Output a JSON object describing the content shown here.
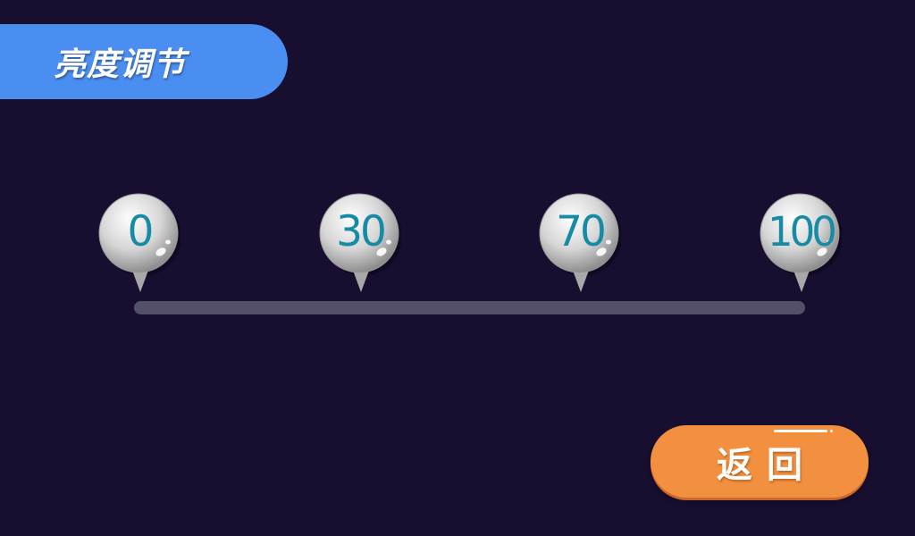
{
  "header": {
    "title": "亮度调节"
  },
  "slider": {
    "levels": [
      {
        "label": "0",
        "value": 0
      },
      {
        "label": "30",
        "value": 30
      },
      {
        "label": "70",
        "value": 70
      },
      {
        "label": "100",
        "value": 100
      }
    ]
  },
  "footer": {
    "back_label": "返回"
  },
  "colors": {
    "background": "#180e30",
    "title_pill": "#4b8ef2",
    "track": "#55506a",
    "marker_text": "#178ba6",
    "back_button": "#f2903f"
  }
}
